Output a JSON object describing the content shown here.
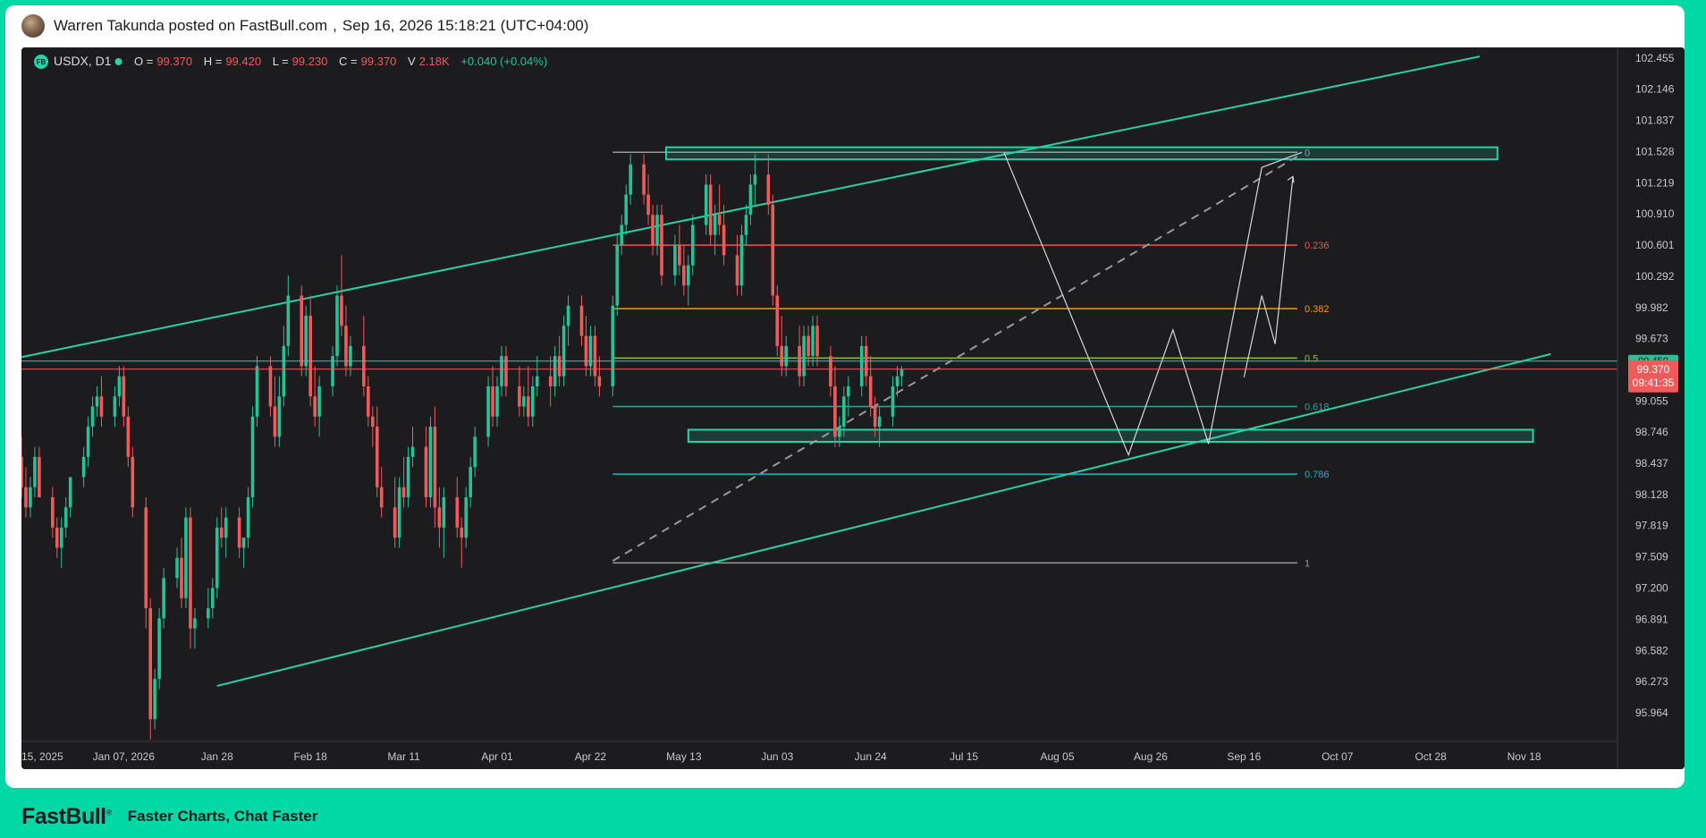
{
  "post": {
    "author_line": "Warren Takunda posted on FastBull.com",
    "separator": ",",
    "timestamp": "Sep 16, 2026 15:18:21 (UTC+04:00)"
  },
  "footer": {
    "brand": "FastBull",
    "brand_mark": "®",
    "tagline": "Faster Charts, Chat Faster"
  },
  "colors": {
    "up": "#26c197",
    "down": "#ef5a5a",
    "channel": "#27d3a6",
    "background": "#1c1c1f"
  },
  "chart_data": {
    "type": "candlestick",
    "symbol": "USDX",
    "symbol_badge": "FB",
    "timeframe": "D1",
    "ohlcv": {
      "O_label": "O =",
      "O": "99.370",
      "H_label": "H =",
      "H": "99.420",
      "L_label": "L =",
      "L": "99.230",
      "C_label": "C =",
      "C": "99.370",
      "V_label": "V",
      "V": "2.18K",
      "change": "+0.040 (+0.04%)"
    },
    "x_axis": {
      "labels": [
        "15, 2025",
        "Jan 07, 2026",
        "Jan 28",
        "Feb 18",
        "Mar 11",
        "Apr 01",
        "Apr 22",
        "May 13",
        "Jun 03",
        "Jun 24",
        "Jul 15",
        "Aug 05",
        "Aug 26",
        "Sep 16",
        "Oct 07",
        "Oct 28",
        "Nov 18"
      ],
      "start_date": "2025-12-15",
      "visible_range": [
        "2025-12-15",
        "2026-12-09"
      ]
    },
    "y_axis": {
      "ticks": [
        "102.455",
        "102.146",
        "101.837",
        "101.528",
        "101.219",
        "100.910",
        "100.601",
        "100.292",
        "99.982",
        "99.673",
        "99.364",
        "99.055",
        "98.746",
        "98.437",
        "98.128",
        "97.819",
        "97.509",
        "97.200",
        "96.891",
        "96.582",
        "96.273",
        "95.964"
      ],
      "range": [
        95.68,
        102.56
      ]
    },
    "current_price": {
      "value": "99.370",
      "countdown": "09:41:35",
      "value_number": 99.37
    },
    "secondary_line": {
      "value_number": 99.45,
      "label": "99.450"
    },
    "fibonacci": {
      "start_date": "2026-04-27",
      "end_date": "2026-09-28",
      "levels": [
        {
          "ratio": "0",
          "price": 101.52,
          "color": "#9a9a9a"
        },
        {
          "ratio": "0.236",
          "price": 100.6,
          "color": "#ef5350"
        },
        {
          "ratio": "0.382",
          "price": 99.97,
          "color": "#ff9800"
        },
        {
          "ratio": "0.5",
          "price": 99.48,
          "color": "#8bc34a"
        },
        {
          "ratio": "0.618",
          "price": 99.0,
          "color": "#26a69a"
        },
        {
          "ratio": "0.786",
          "price": 98.33,
          "color": "#00bcd4"
        },
        {
          "ratio": "1",
          "price": 97.45,
          "color": "#9a9a9a"
        }
      ]
    },
    "zones": [
      {
        "name": "supply-zone",
        "start": "2026-05-09",
        "end": "2026-11-12",
        "top": 101.57,
        "bottom": 101.45
      },
      {
        "name": "demand-zone",
        "start": "2026-05-14",
        "end": "2026-11-20",
        "top": 98.77,
        "bottom": 98.65
      }
    ],
    "channel_lines": [
      {
        "name": "upper-channel",
        "points": [
          [
            "2025-12-15",
            99.49
          ],
          [
            "2026-11-08",
            102.47
          ]
        ]
      },
      {
        "name": "lower-channel",
        "points": [
          [
            "2026-01-28",
            96.23
          ],
          [
            "2026-11-24",
            99.52
          ]
        ]
      }
    ],
    "trend_line": {
      "points": [
        [
          "2026-04-27",
          97.47
        ],
        [
          "2026-09-28",
          101.48
        ]
      ]
    },
    "projection_path": [
      [
        "2026-07-24",
        101.52
      ],
      [
        "2026-08-21",
        98.52
      ],
      [
        "2026-08-31",
        99.76
      ],
      [
        "2026-09-08",
        98.63
      ],
      [
        "2026-09-20",
        101.37
      ],
      [
        "2026-09-29",
        101.52
      ]
    ],
    "projection_path2": [
      [
        "2026-09-16",
        99.29
      ],
      [
        "2026-09-20",
        100.1
      ],
      [
        "2026-09-23",
        99.62
      ],
      [
        "2026-09-27",
        101.28
      ]
    ],
    "candles": [
      [
        98.5,
        98.7,
        98.1,
        98.2
      ],
      [
        98.2,
        98.4,
        97.9,
        98.0
      ],
      [
        98.0,
        98.3,
        97.9,
        98.2
      ],
      [
        98.2,
        98.6,
        98.1,
        98.5
      ],
      [
        98.5,
        98.6,
        98.1,
        98.1
      ],
      [
        98.1,
        98.2,
        97.7,
        97.8
      ],
      [
        97.8,
        97.9,
        97.5,
        97.6
      ],
      [
        97.6,
        97.9,
        97.4,
        97.8
      ],
      [
        97.8,
        98.1,
        97.7,
        98.0
      ],
      [
        98.0,
        98.3,
        97.9,
        98.3
      ],
      [
        98.3,
        98.6,
        98.2,
        98.5
      ],
      [
        98.5,
        98.9,
        98.4,
        98.8
      ],
      [
        98.8,
        99.1,
        98.7,
        99.0
      ],
      [
        99.0,
        99.2,
        98.9,
        99.1
      ],
      [
        99.1,
        99.3,
        98.8,
        98.9
      ],
      [
        98.9,
        99.2,
        98.8,
        99.1
      ],
      [
        99.1,
        99.4,
        99.0,
        99.3
      ],
      [
        99.3,
        99.4,
        98.8,
        98.9
      ],
      [
        98.9,
        99.0,
        98.4,
        98.5
      ],
      [
        98.5,
        98.6,
        97.9,
        98.0
      ],
      [
        98.0,
        98.1,
        96.8,
        97.0
      ],
      [
        97.0,
        97.1,
        95.7,
        95.9
      ],
      [
        95.9,
        96.4,
        95.8,
        96.3
      ],
      [
        96.3,
        97.0,
        96.2,
        96.9
      ],
      [
        96.9,
        97.4,
        96.8,
        97.3
      ],
      [
        97.3,
        97.6,
        97.2,
        97.5
      ],
      [
        97.5,
        97.7,
        97.0,
        97.1
      ],
      [
        97.1,
        98.0,
        97.0,
        97.9
      ],
      [
        97.9,
        98.0,
        96.6,
        96.8
      ],
      [
        96.8,
        97.0,
        96.6,
        96.9
      ],
      [
        96.9,
        97.2,
        96.8,
        97.0
      ],
      [
        97.0,
        97.3,
        96.9,
        97.2
      ],
      [
        97.2,
        97.9,
        97.1,
        97.8
      ],
      [
        97.8,
        98.0,
        97.6,
        97.7
      ],
      [
        97.7,
        98.0,
        97.5,
        97.9
      ],
      [
        97.9,
        98.0,
        97.5,
        97.6
      ],
      [
        97.6,
        97.7,
        97.4,
        97.7
      ],
      [
        97.7,
        98.2,
        97.6,
        98.1
      ],
      [
        98.1,
        99.0,
        98.0,
        98.9
      ],
      [
        98.9,
        99.5,
        98.8,
        99.4
      ],
      [
        99.4,
        99.5,
        98.9,
        99.0
      ],
      [
        99.0,
        99.3,
        98.6,
        98.7
      ],
      [
        98.7,
        99.3,
        98.6,
        99.1
      ],
      [
        99.1,
        99.8,
        99.0,
        99.6
      ],
      [
        99.6,
        100.3,
        99.5,
        100.1
      ],
      [
        100.1,
        100.2,
        99.3,
        99.4
      ],
      [
        99.4,
        100.0,
        99.3,
        99.9
      ],
      [
        99.9,
        100.1,
        99.0,
        99.1
      ],
      [
        99.1,
        99.4,
        98.8,
        98.9
      ],
      [
        98.9,
        99.3,
        98.7,
        99.2
      ],
      [
        99.2,
        99.6,
        99.1,
        99.5
      ],
      [
        99.5,
        100.2,
        99.4,
        100.1
      ],
      [
        100.1,
        100.5,
        99.7,
        99.8
      ],
      [
        99.8,
        100.0,
        99.3,
        99.4
      ],
      [
        99.4,
        99.7,
        99.3,
        99.6
      ],
      [
        99.6,
        99.9,
        99.1,
        99.2
      ],
      [
        99.2,
        99.3,
        98.8,
        98.9
      ],
      [
        98.9,
        99.0,
        98.6,
        98.8
      ],
      [
        98.8,
        99.0,
        98.1,
        98.2
      ],
      [
        98.2,
        98.4,
        97.9,
        98.0
      ],
      [
        98.0,
        98.3,
        97.6,
        97.7
      ],
      [
        97.7,
        98.3,
        97.6,
        98.2
      ],
      [
        98.2,
        98.5,
        98.0,
        98.1
      ],
      [
        98.1,
        98.6,
        98.0,
        98.5
      ],
      [
        98.5,
        98.8,
        98.4,
        98.6
      ],
      [
        98.6,
        98.8,
        98.0,
        98.1
      ],
      [
        98.1,
        98.9,
        98.0,
        98.8
      ],
      [
        98.8,
        99.0,
        97.8,
        98.0
      ],
      [
        98.0,
        98.2,
        97.6,
        97.8
      ],
      [
        97.8,
        98.2,
        97.5,
        98.1
      ],
      [
        98.1,
        98.3,
        97.7,
        97.8
      ],
      [
        97.8,
        97.9,
        97.4,
        97.7
      ],
      [
        97.7,
        98.2,
        97.6,
        98.1
      ],
      [
        98.1,
        98.5,
        98.0,
        98.4
      ],
      [
        98.4,
        98.8,
        98.3,
        98.7
      ],
      [
        98.7,
        99.3,
        98.6,
        99.2
      ],
      [
        99.2,
        99.4,
        98.8,
        98.9
      ],
      [
        98.9,
        99.3,
        98.8,
        99.2
      ],
      [
        99.2,
        99.6,
        99.1,
        99.5
      ],
      [
        99.5,
        99.6,
        99.1,
        99.2
      ],
      [
        99.2,
        99.4,
        98.9,
        99.0
      ],
      [
        99.0,
        99.2,
        98.9,
        99.1
      ],
      [
        99.1,
        99.4,
        98.8,
        98.9
      ],
      [
        98.9,
        99.3,
        98.8,
        99.2
      ],
      [
        99.2,
        99.5,
        99.1,
        99.3
      ],
      [
        99.3,
        99.5,
        99.0,
        99.2
      ],
      [
        99.2,
        99.6,
        99.1,
        99.5
      ],
      [
        99.5,
        99.7,
        99.2,
        99.3
      ],
      [
        99.3,
        99.9,
        99.2,
        99.8
      ],
      [
        99.8,
        100.1,
        99.6,
        100.0
      ],
      [
        100.0,
        100.1,
        99.6,
        99.7
      ],
      [
        99.7,
        99.9,
        99.3,
        99.4
      ],
      [
        99.4,
        99.8,
        99.3,
        99.7
      ],
      [
        99.7,
        99.8,
        99.2,
        99.3
      ],
      [
        99.3,
        99.5,
        99.1,
        99.2
      ],
      [
        99.2,
        100.1,
        99.1,
        100.0
      ],
      [
        100.0,
        100.7,
        99.9,
        100.6
      ],
      [
        100.6,
        100.9,
        100.5,
        100.8
      ],
      [
        100.8,
        101.2,
        100.7,
        101.1
      ],
      [
        101.1,
        101.5,
        101.0,
        101.4
      ],
      [
        101.4,
        101.5,
        101.0,
        101.1
      ],
      [
        101.1,
        101.3,
        100.8,
        100.9
      ],
      [
        100.9,
        101.0,
        100.5,
        100.6
      ],
      [
        100.6,
        101.0,
        100.5,
        100.9
      ],
      [
        100.9,
        101.0,
        100.2,
        100.3
      ],
      [
        100.3,
        100.7,
        100.2,
        100.6
      ],
      [
        100.6,
        100.8,
        100.3,
        100.4
      ],
      [
        100.4,
        100.6,
        100.1,
        100.2
      ],
      [
        100.2,
        100.5,
        100.0,
        100.4
      ],
      [
        100.4,
        100.9,
        100.3,
        100.8
      ],
      [
        100.8,
        101.3,
        100.7,
        101.2
      ],
      [
        101.2,
        101.3,
        100.6,
        100.7
      ],
      [
        100.7,
        101.0,
        100.5,
        100.9
      ],
      [
        100.9,
        101.2,
        100.7,
        100.8
      ],
      [
        100.8,
        101.0,
        100.4,
        100.5
      ],
      [
        100.5,
        100.7,
        100.1,
        100.2
      ],
      [
        100.2,
        100.8,
        100.1,
        100.7
      ],
      [
        100.7,
        101.0,
        100.6,
        100.9
      ],
      [
        100.9,
        101.3,
        100.8,
        101.2
      ],
      [
        101.2,
        101.5,
        101.0,
        101.3
      ],
      [
        101.3,
        101.5,
        100.9,
        101.0
      ],
      [
        101.0,
        101.1,
        100.0,
        100.1
      ],
      [
        100.1,
        100.2,
        99.5,
        99.6
      ],
      [
        99.6,
        99.9,
        99.3,
        99.4
      ],
      [
        99.4,
        99.7,
        99.3,
        99.6
      ],
      [
        99.6,
        99.8,
        99.2,
        99.3
      ],
      [
        99.3,
        99.8,
        99.2,
        99.7
      ],
      [
        99.7,
        99.8,
        99.4,
        99.5
      ],
      [
        99.5,
        99.9,
        99.4,
        99.8
      ],
      [
        99.8,
        99.9,
        99.4,
        99.5
      ],
      [
        99.5,
        99.6,
        99.1,
        99.2
      ],
      [
        99.2,
        99.4,
        98.6,
        98.7
      ],
      [
        98.7,
        98.9,
        98.6,
        98.8
      ],
      [
        98.8,
        99.2,
        98.7,
        99.1
      ],
      [
        99.1,
        99.3,
        98.9,
        99.2
      ],
      [
        99.2,
        99.7,
        99.1,
        99.6
      ],
      [
        99.6,
        99.7,
        99.2,
        99.3
      ],
      [
        99.3,
        99.5,
        98.9,
        99.0
      ],
      [
        99.0,
        99.1,
        98.7,
        98.8
      ],
      [
        98.8,
        99.0,
        98.6,
        98.9
      ],
      [
        98.9,
        99.3,
        98.8,
        99.2
      ],
      [
        99.2,
        99.4,
        99.1,
        99.3
      ],
      [
        99.3,
        99.4,
        99.2,
        99.37
      ]
    ]
  }
}
